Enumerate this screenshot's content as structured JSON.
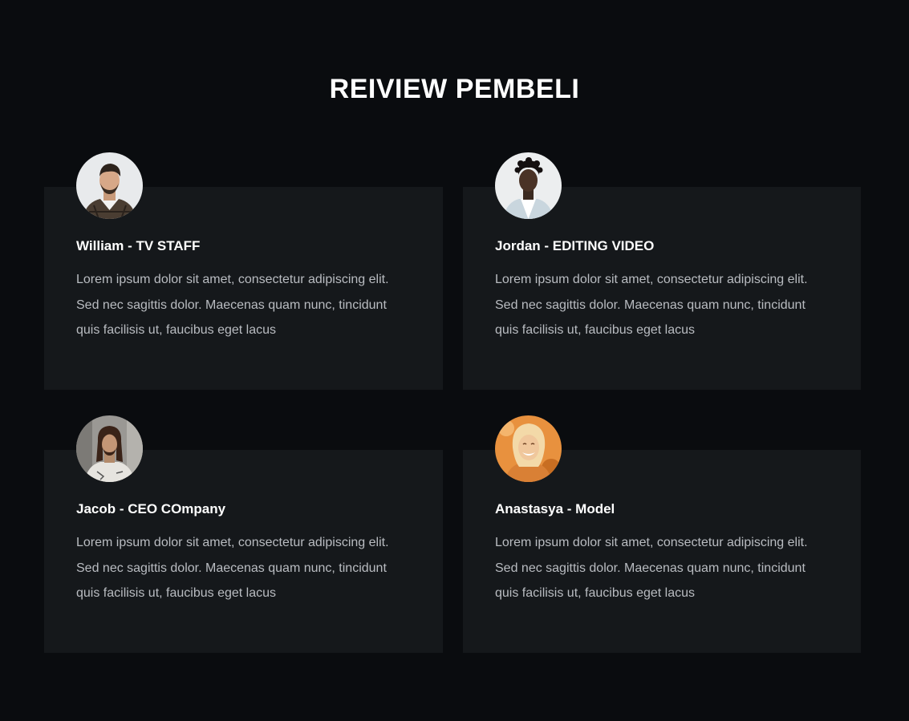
{
  "section": {
    "title": "REIVIEW PEMBELI"
  },
  "reviews": [
    {
      "name": "William - TV STAFF",
      "text": "Lorem ipsum dolor sit amet, consectetur adipiscing elit. Sed nec sagittis dolor. Maecenas quam nunc, tincidunt quis facilisis ut, faucibus eget lacus",
      "avatar": "man-beard-plaid-shirt-photo"
    },
    {
      "name": "Jordan - EDITING VIDEO",
      "text": "Lorem ipsum dolor sit amet, consectetur adipiscing elit. Sed nec sagittis dolor. Maecenas quam nunc, tincidunt quis facilisis ut, faucibus eget lacus",
      "avatar": "man-curly-hair-photo"
    },
    {
      "name": "Jacob - CEO COmpany",
      "text": "Lorem ipsum dolor sit amet, consectetur adipiscing elit. Sed nec sagittis dolor. Maecenas quam nunc, tincidunt quis facilisis ut, faucibus eget lacus",
      "avatar": "man-long-hair-photo"
    },
    {
      "name": "Anastasya - Model",
      "text": "Lorem ipsum dolor sit amet, consectetur adipiscing elit. Sed nec sagittis dolor. Maecenas quam nunc, tincidunt quis facilisis ut, faucibus eget lacus",
      "avatar": "woman-smiling-photo"
    }
  ],
  "colors": {
    "background": "#0a0c0f",
    "card": "#15181b",
    "heading": "#ffffff",
    "body_text": "#b9bcc1"
  }
}
